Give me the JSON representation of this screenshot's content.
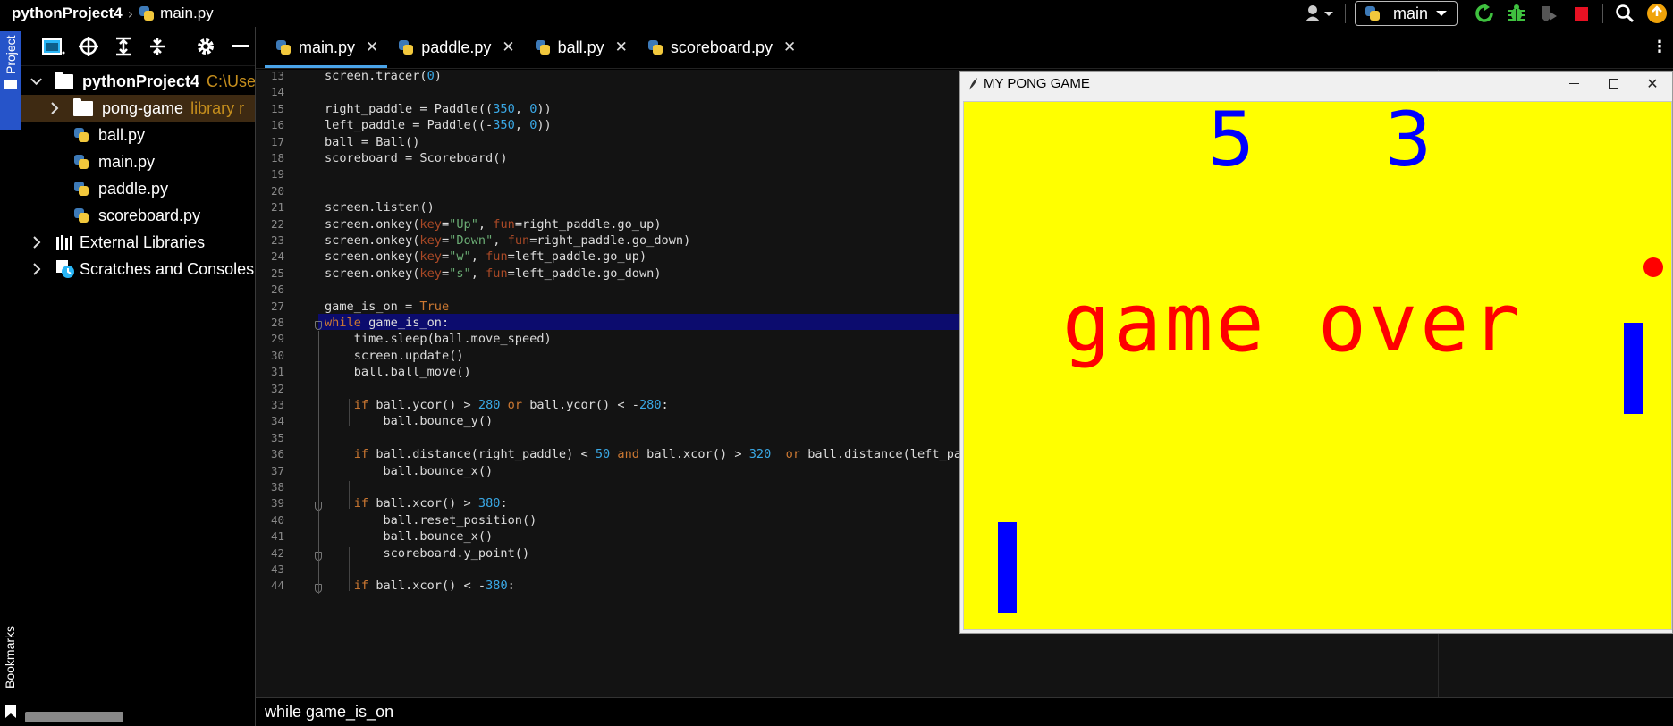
{
  "titlebar": {
    "project": "pythonProject4",
    "file": "main.py",
    "branch": "main"
  },
  "side_strip": {
    "project_label": "Project",
    "bookmarks_label": "Bookmarks"
  },
  "project_tree": [
    {
      "name": "pythonProject4",
      "extra": "C:\\Use",
      "type": "project"
    },
    {
      "name": "pong-game",
      "extra": "library r",
      "type": "folder"
    },
    {
      "name": "ball.py",
      "type": "file"
    },
    {
      "name": "main.py",
      "type": "file"
    },
    {
      "name": "paddle.py",
      "type": "file"
    },
    {
      "name": "scoreboard.py",
      "type": "file"
    },
    {
      "name": "External Libraries",
      "type": "libs"
    },
    {
      "name": "Scratches and Consoles",
      "type": "scratches"
    }
  ],
  "tabs": [
    {
      "label": "main.py",
      "active": true
    },
    {
      "label": "paddle.py",
      "active": false
    },
    {
      "label": "ball.py",
      "active": false
    },
    {
      "label": "scoreboard.py",
      "active": false
    }
  ],
  "editor": {
    "current_line": 28,
    "lines": [
      {
        "n": "13",
        "code": [
          [
            "fn",
            "screen.tracer("
          ],
          [
            "num",
            "0"
          ],
          [
            "fn",
            ")"
          ]
        ]
      },
      {
        "n": "14",
        "code": []
      },
      {
        "n": "15",
        "code": [
          [
            "fn",
            "right_paddle = Paddle(("
          ],
          [
            "num",
            "350"
          ],
          [
            "fn",
            ", "
          ],
          [
            "num",
            "0"
          ],
          [
            "fn",
            "))"
          ]
        ]
      },
      {
        "n": "16",
        "code": [
          [
            "fn",
            "left_paddle = Paddle((-"
          ],
          [
            "num",
            "350"
          ],
          [
            "fn",
            ", "
          ],
          [
            "num",
            "0"
          ],
          [
            "fn",
            "))"
          ]
        ]
      },
      {
        "n": "17",
        "code": [
          [
            "fn",
            "ball = Ball()"
          ]
        ]
      },
      {
        "n": "18",
        "code": [
          [
            "fn",
            "scoreboard = Scoreboard()"
          ]
        ]
      },
      {
        "n": "19",
        "code": []
      },
      {
        "n": "20",
        "code": []
      },
      {
        "n": "21",
        "code": [
          [
            "fn",
            "screen.listen()"
          ]
        ]
      },
      {
        "n": "22",
        "code": [
          [
            "fn",
            "screen.onkey("
          ],
          [
            "param",
            "key"
          ],
          [
            "fn",
            "="
          ],
          [
            "str",
            "\"Up\""
          ],
          [
            "fn",
            ", "
          ],
          [
            "param",
            "fun"
          ],
          [
            "fn",
            "=right_paddle.go_up)"
          ]
        ]
      },
      {
        "n": "23",
        "code": [
          [
            "fn",
            "screen.onkey("
          ],
          [
            "param",
            "key"
          ],
          [
            "fn",
            "="
          ],
          [
            "str",
            "\"Down\""
          ],
          [
            "fn",
            ", "
          ],
          [
            "param",
            "fun"
          ],
          [
            "fn",
            "=right_paddle.go_down)"
          ]
        ]
      },
      {
        "n": "24",
        "code": [
          [
            "fn",
            "screen.onkey("
          ],
          [
            "param",
            "key"
          ],
          [
            "fn",
            "="
          ],
          [
            "str",
            "\"w\""
          ],
          [
            "fn",
            ", "
          ],
          [
            "param",
            "fun"
          ],
          [
            "fn",
            "=left_paddle.go_up)"
          ]
        ]
      },
      {
        "n": "25",
        "code": [
          [
            "fn",
            "screen.onkey("
          ],
          [
            "param",
            "key"
          ],
          [
            "fn",
            "="
          ],
          [
            "str",
            "\"s\""
          ],
          [
            "fn",
            ", "
          ],
          [
            "param",
            "fun"
          ],
          [
            "fn",
            "=left_paddle.go_down)"
          ]
        ]
      },
      {
        "n": "26",
        "code": []
      },
      {
        "n": "27",
        "code": [
          [
            "fn",
            "game_is_on = "
          ],
          [
            "kw",
            "True"
          ]
        ]
      },
      {
        "n": "28",
        "code": [
          [
            "kw",
            "while "
          ],
          [
            "fn",
            "game_is_on:"
          ]
        ]
      },
      {
        "n": "29",
        "code": [
          [
            "fn",
            "    time.sleep(ball.move_speed)"
          ]
        ]
      },
      {
        "n": "30",
        "code": [
          [
            "fn",
            "    screen.update()"
          ]
        ]
      },
      {
        "n": "31",
        "code": [
          [
            "fn",
            "    ball.ball_move()"
          ]
        ]
      },
      {
        "n": "32",
        "code": []
      },
      {
        "n": "33",
        "code": [
          [
            "fn",
            "    "
          ],
          [
            "kw",
            "if "
          ],
          [
            "fn",
            "ball.ycor() > "
          ],
          [
            "num",
            "280"
          ],
          [
            "kw",
            " or "
          ],
          [
            "fn",
            "ball.ycor() < -"
          ],
          [
            "num",
            "280"
          ],
          [
            "fn",
            ":"
          ]
        ]
      },
      {
        "n": "34",
        "code": [
          [
            "fn",
            "        ball.bounce_y()"
          ]
        ]
      },
      {
        "n": "35",
        "code": []
      },
      {
        "n": "36",
        "code": [
          [
            "fn",
            "    "
          ],
          [
            "kw",
            "if "
          ],
          [
            "fn",
            "ball.distance(right_paddle) < "
          ],
          [
            "num",
            "50"
          ],
          [
            "kw",
            " and "
          ],
          [
            "fn",
            "ball.xcor() > "
          ],
          [
            "num",
            "320"
          ],
          [
            "kw",
            "  or "
          ],
          [
            "fn",
            "ball.distance(left_paddle"
          ]
        ]
      },
      {
        "n": "37",
        "code": [
          [
            "fn",
            "        ball.bounce_x()"
          ]
        ]
      },
      {
        "n": "38",
        "code": []
      },
      {
        "n": "39",
        "code": [
          [
            "fn",
            "    "
          ],
          [
            "kw",
            "if "
          ],
          [
            "fn",
            "ball.xcor() > "
          ],
          [
            "num",
            "380"
          ],
          [
            "fn",
            ":"
          ]
        ]
      },
      {
        "n": "40",
        "code": [
          [
            "fn",
            "        ball.reset_position()"
          ]
        ]
      },
      {
        "n": "41",
        "code": [
          [
            "fn",
            "        ball.bounce_x()"
          ]
        ]
      },
      {
        "n": "42",
        "code": [
          [
            "fn",
            "        scoreboard.y_point()"
          ]
        ]
      },
      {
        "n": "43",
        "code": []
      },
      {
        "n": "44",
        "code": [
          [
            "fn",
            "    "
          ],
          [
            "kw",
            "if "
          ],
          [
            "fn",
            "ball.xcor() < -"
          ],
          [
            "num",
            "380"
          ],
          [
            "fn",
            ":"
          ]
        ]
      }
    ]
  },
  "breadcrumb": "while game_is_on",
  "pong": {
    "title": "MY PONG GAME",
    "left_score": "5",
    "right_score": "3",
    "message": "game over",
    "background_color": "#ffff00",
    "paddle_color": "#0000ff",
    "ball_color": "#ff0000",
    "text_color": "#ff0000",
    "score_color": "#0000ff"
  },
  "colors": {
    "accent": "#4aa3e8",
    "current_line": "#0c0c6e",
    "keyword": "#cc7832",
    "number": "#3aa8e5",
    "string": "#6aab73",
    "param": "#aa4926",
    "library_tag": "#c58e1d",
    "project_tab": "#2654c9"
  }
}
